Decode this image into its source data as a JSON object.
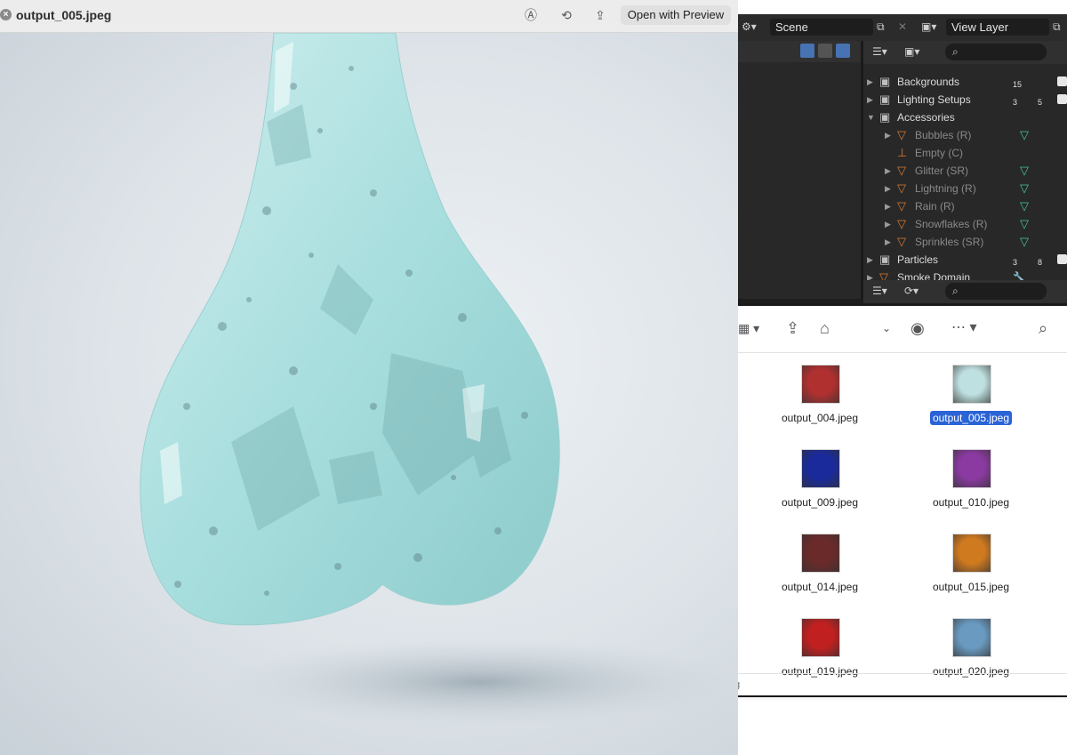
{
  "preview": {
    "title": "output_005.jpeg",
    "open_with_label": "Open with Preview",
    "close_glyph": "×"
  },
  "blender": {
    "scene_name": "Scene",
    "view_layer": "View Layer",
    "outliner": [
      {
        "label": "Backgrounds",
        "badge": "15",
        "depth": 0
      },
      {
        "label": "Lighting Setups",
        "badge": "3",
        "badge2": "5",
        "depth": 0
      },
      {
        "label": "Accessories",
        "depth": 0
      },
      {
        "label": "Bubbles (R)",
        "depth": 1
      },
      {
        "label": "Empty (C)",
        "depth": 1
      },
      {
        "label": "Glitter (SR)",
        "depth": 1
      },
      {
        "label": "Lightning (R)",
        "depth": 1
      },
      {
        "label": "Rain (R)",
        "depth": 1
      },
      {
        "label": "Snowflakes (R)",
        "depth": 1
      },
      {
        "label": "Sprinkles (SR)",
        "depth": 1
      },
      {
        "label": "Particles",
        "badge": "3",
        "badge2": "8",
        "depth": 0
      },
      {
        "label": "Smoke Domain",
        "depth": 0
      }
    ]
  },
  "finder": {
    "files": [
      {
        "name": "output_004.jpeg",
        "color": "#b03030",
        "selected": false
      },
      {
        "name": "output_005.jpeg",
        "color": "#bfe0e0",
        "selected": true
      },
      {
        "name": "output_009.jpeg",
        "color": "#1a2a9a",
        "selected": false
      },
      {
        "name": "output_010.jpeg",
        "color": "#8a3aa0",
        "selected": false
      },
      {
        "name": "output_014.jpeg",
        "color": "#6a2a2a",
        "selected": false
      },
      {
        "name": "output_015.jpeg",
        "color": "#d07a20",
        "selected": false
      },
      {
        "name": "output_019.jpeg",
        "color": "#c02020",
        "selected": false
      },
      {
        "name": "output_020.jpeg",
        "color": "#6a9ac0",
        "selected": false
      }
    ],
    "status_text": "g"
  },
  "colors": {
    "selection": "#2a63d6",
    "blender_bg": "#1d1d1d",
    "outliner_orange": "#d87a32",
    "outliner_green": "#44c4a0"
  }
}
